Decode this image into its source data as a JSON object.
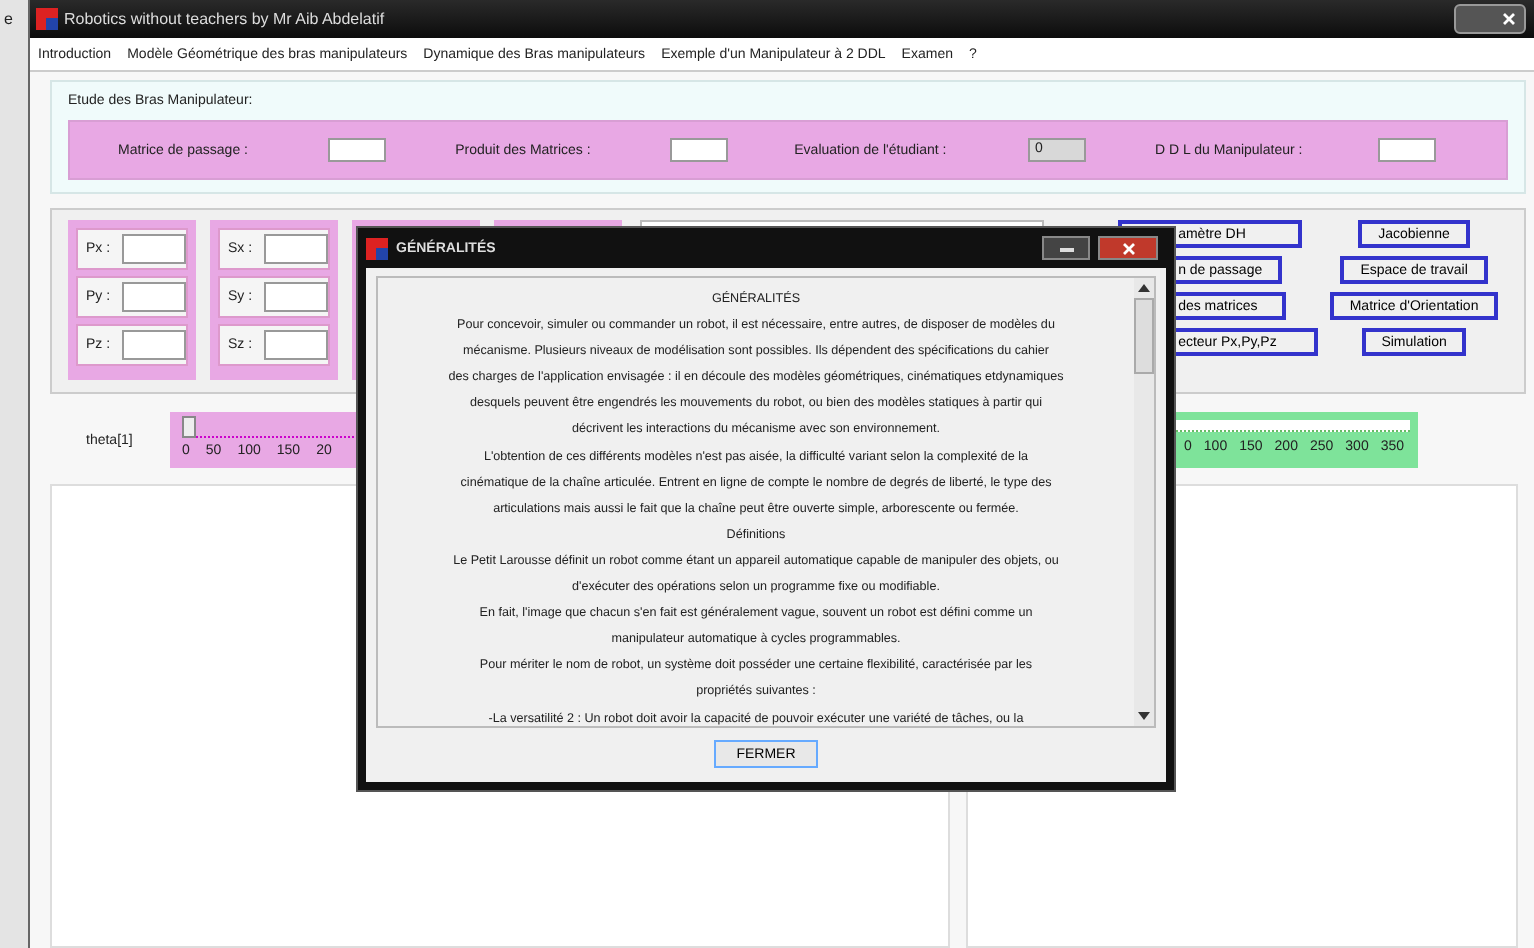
{
  "background_window": {
    "text": "e"
  },
  "window": {
    "title": "Robotics without teachers by Mr Aib Abdelatif"
  },
  "menu": [
    "Introduction",
    "Modèle Géométrique des bras manipulateurs",
    "Dynamique des Bras manipulateurs",
    "Exemple d'un Manipulateur à 2 DDL",
    "Examen",
    "?"
  ],
  "study_group": {
    "title": "Etude des Bras Manipulateur:",
    "fields": [
      {
        "label": "Matrice de passage :",
        "disabled": false
      },
      {
        "label": "Produit des Matrices :",
        "disabled": false
      },
      {
        "label": "Evaluation de l'étudiant :",
        "value": "0",
        "disabled": true
      },
      {
        "label": "D D L du Manipulateur :",
        "disabled": false
      }
    ]
  },
  "field_groups": [
    {
      "labels": [
        "Px :",
        "Py :",
        "Pz :"
      ]
    },
    {
      "labels": [
        "Sx :",
        "Sy :",
        "Sz :"
      ]
    }
  ],
  "buttons_left": [
    "amètre DH",
    "n de passage",
    "des matrices",
    "ecteur Px,Py,Pz"
  ],
  "buttons_right": [
    "Jacobienne",
    "Espace de travail",
    "Matrice d'Orientation",
    "Simulation"
  ],
  "slider": {
    "label": "theta[1]",
    "level": 0,
    "ticks": [
      "0",
      "50",
      "100",
      "150",
      "20"
    ]
  },
  "slider_2": {
    "ticks": [
      "0",
      "100",
      "150",
      "200",
      "250",
      "300",
      "350"
    ]
  },
  "dialog": {
    "title": "GÉNÉRALITÉS",
    "lines": [
      "GÉNÉRALITÉS",
      "Pour concevoir, simuler ou commander un robot, il est nécessaire, entre autres, de disposer de modèles du",
      "mécanisme. Plusieurs niveaux de modélisation sont possibles. Ils dépendent des spécifications du cahier",
      "des charges de l'application envisagée : il en découle des modèles géométriques, cinématiques etdynamiques",
      "desquels peuvent être engendrés les mouvements du robot, ou bien des modèles statiques à partir qui",
      "décrivent les interactions du mécanisme avec son environnement.",
      "L'obtention de ces différents modèles n'est pas aisée, la difficulté variant selon la complexité de la",
      "cinématique de la chaîne articulée. Entrent en ligne de compte le nombre de degrés de liberté, le type des",
      "articulations mais aussi le fait que la chaîne peut être ouverte simple, arborescente ou fermée.",
      "Définitions",
      "Le Petit Larousse définit un robot comme étant un appareil automatique capable de manipuler des objets, ou",
      "d'exécuter des opérations selon un programme fixe ou modifiable.",
      "En fait, l'image que chacun s'en fait est généralement vague, souvent un robot est défini comme un",
      "manipulateur automatique à cycles programmables.",
      "Pour mériter le nom de robot, un système doit posséder une certaine flexibilité, caractérisée par les",
      "propriétés suivantes :",
      "-La versatilité 2 : Un robot doit avoir la capacité de pouvoir exécuter une variété de tâches, ou la"
    ],
    "button": "FERMER"
  }
}
